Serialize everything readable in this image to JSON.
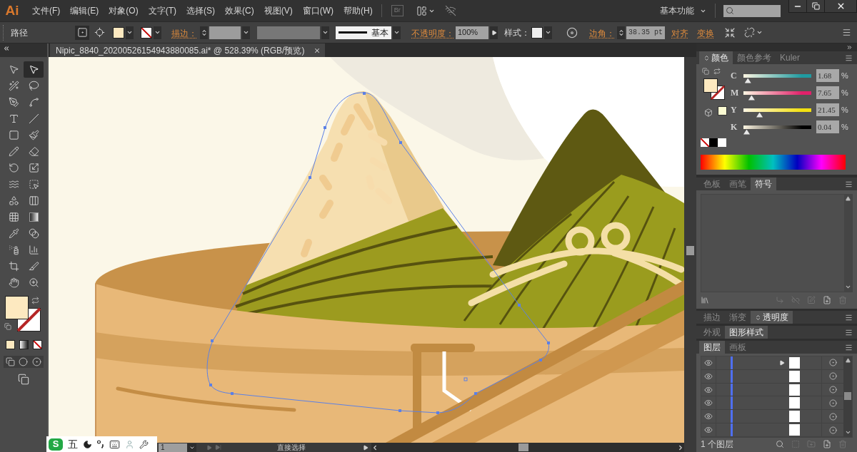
{
  "app": {
    "logo": "Ai"
  },
  "menu": [
    "文件(F)",
    "编辑(E)",
    "对象(O)",
    "文字(T)",
    "选择(S)",
    "效果(C)",
    "视图(V)",
    "窗口(W)",
    "帮助(H)"
  ],
  "title_bar": {
    "bridge": "Br",
    "workspace": "基本功能"
  },
  "control_bar": {
    "selection": "路径",
    "stroke_label": "描边：",
    "stroke_profile": "基本",
    "opacity_label": "不透明度：",
    "opacity": "100%",
    "style_label": "样式：",
    "corner_label": "边角：",
    "corner": "38.35 pt",
    "links": [
      "对齐",
      "变换"
    ]
  },
  "document_tab": {
    "title": "Nipic_8840_20200526154943880085.ai* @ 528.39% (RGB/预览)"
  },
  "tools": [
    {
      "kind": "selection",
      "selected": false
    },
    {
      "kind": "direct",
      "selected": true
    },
    {
      "kind": "wand",
      "selected": false
    },
    {
      "kind": "lasso",
      "selected": false
    },
    {
      "kind": "pen",
      "selected": false
    },
    {
      "kind": "curvature",
      "selected": false
    },
    {
      "kind": "type",
      "selected": false
    },
    {
      "kind": "line",
      "selected": false
    },
    {
      "kind": "rectangle",
      "selected": false
    },
    {
      "kind": "brush",
      "selected": false
    },
    {
      "kind": "pencil",
      "selected": false
    },
    {
      "kind": "eraser",
      "selected": false
    },
    {
      "kind": "rotate",
      "selected": false
    },
    {
      "kind": "scale",
      "selected": false
    },
    {
      "kind": "warp",
      "selected": false
    },
    {
      "kind": "freetransform",
      "selected": false
    },
    {
      "kind": "shapebuilder",
      "selected": false
    },
    {
      "kind": "perspective",
      "selected": false
    },
    {
      "kind": "mesh",
      "selected": false
    },
    {
      "kind": "gradient",
      "selected": false
    },
    {
      "kind": "eyedropper",
      "selected": false
    },
    {
      "kind": "blend",
      "selected": false
    },
    {
      "kind": "sprayer",
      "selected": false
    },
    {
      "kind": "graph",
      "selected": false
    },
    {
      "kind": "artboard",
      "selected": false
    },
    {
      "kind": "slice",
      "selected": false
    },
    {
      "kind": "hand",
      "selected": false
    },
    {
      "kind": "zoom",
      "selected": false
    }
  ],
  "color_panel": {
    "options_toggle": true,
    "tabs": [
      {
        "label": "颜色",
        "selected": true
      },
      {
        "label": "颜色参考",
        "selected": false
      },
      {
        "label": "Kuler",
        "selected": false
      }
    ],
    "channels": [
      {
        "name": "C",
        "color": "#1f9aa0",
        "level": 0.02,
        "value": "1.68",
        "unit": "%"
      },
      {
        "name": "M",
        "color": "#e0206a",
        "level": 0.08,
        "value": "7.65",
        "unit": "%"
      },
      {
        "name": "Y",
        "color": "#f2e010",
        "level": 0.21,
        "value": "21.45",
        "unit": "%"
      },
      {
        "name": "K",
        "color": "#000000",
        "level": 0.0,
        "value": "0.04",
        "unit": "%"
      }
    ]
  },
  "symbols_panel": {
    "tabs": [
      {
        "label": "色板",
        "selected": false
      },
      {
        "label": "画笔",
        "selected": false
      },
      {
        "label": "符号",
        "selected": true
      }
    ]
  },
  "transparency_panel": {
    "options_toggle": true,
    "tabs": [
      {
        "label": "描边",
        "selected": false
      },
      {
        "label": "渐变",
        "selected": false
      },
      {
        "label": "透明度",
        "selected": true
      }
    ]
  },
  "styles_panel": {
    "tabs": [
      {
        "label": "外观",
        "selected": false
      },
      {
        "label": "图形样式",
        "selected": true
      }
    ]
  },
  "layers_panel": {
    "tabs": [
      {
        "label": "图层",
        "selected": true
      },
      {
        "label": "画板",
        "selected": false
      }
    ],
    "rows": [
      {
        "kind": "group"
      },
      {
        "kind": "path"
      },
      {
        "kind": "path"
      },
      {
        "kind": "path"
      },
      {
        "kind": "path"
      },
      {
        "kind": "path"
      }
    ],
    "count": "1 个图层"
  },
  "status_bar": {
    "artboard": "1",
    "tool": "直接选择"
  },
  "ime_bar": {
    "logo": "S",
    "mode": "五"
  }
}
